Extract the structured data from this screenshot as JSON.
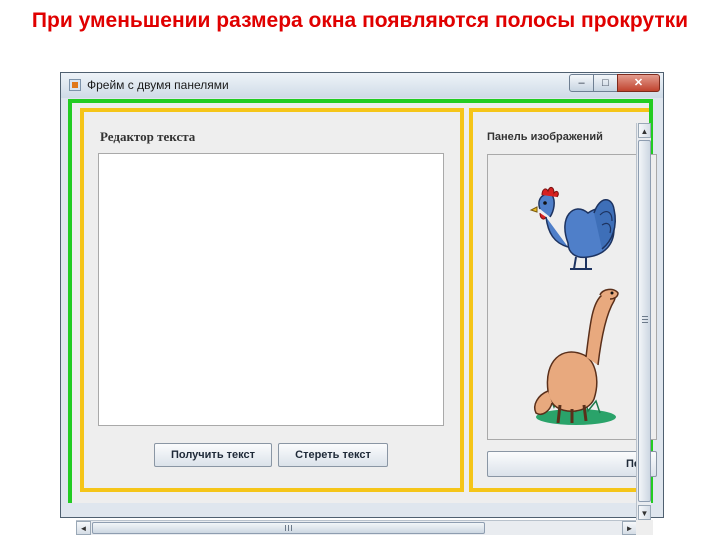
{
  "heading": "При уменьшении размера окна появляются полосы прокрутки",
  "window": {
    "title": "Фрейм с двумя панелями",
    "controls": {
      "minimize": "–",
      "maximize": "□",
      "close": "✕"
    }
  },
  "left_panel": {
    "title": "Редактор текста",
    "text_value": "",
    "buttons": {
      "get": "Получить текст",
      "clear": "Стереть текст"
    }
  },
  "right_panel": {
    "title": "Панель изображений",
    "images": [
      "rooster-image",
      "dinosaur-image"
    ],
    "button_partial": "Пе"
  },
  "colors": {
    "heading": "#e00000",
    "outer_border": "#22cc22",
    "panel_border": "#f5c518"
  },
  "scrollbars": {
    "up": "▲",
    "down": "▼",
    "left": "◄",
    "right": "►"
  }
}
